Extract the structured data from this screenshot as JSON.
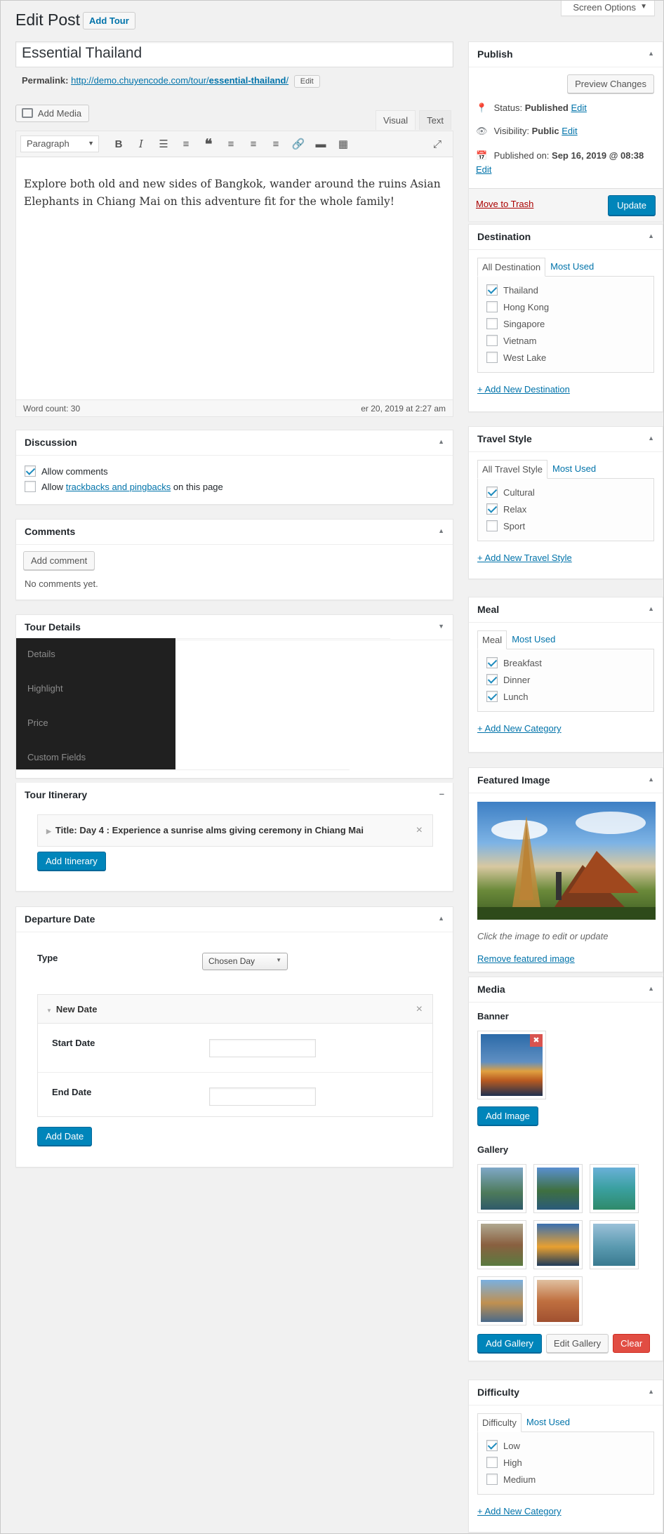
{
  "header": {
    "screen_options": "Screen Options",
    "page_title": "Edit Post",
    "add_tour": "Add Tour"
  },
  "post": {
    "title": "Essential Thailand",
    "permalink_label": "Permalink:",
    "permalink_base": "http://demo.chuyencode.com/tour/",
    "permalink_slug": "essential-thailand",
    "permalink_end": "/",
    "permalink_edit": "Edit"
  },
  "editor": {
    "add_media": "Add Media",
    "tab_visual": "Visual",
    "tab_text": "Text",
    "format_select": "Paragraph",
    "content": "Explore both old and new sides of Bangkok, wander around the ruins  Asian Elephants in Chiang Mai on this adventure fit for the whole family!",
    "word_count": "Word count: 30",
    "last_edited": "er 20, 2019 at 2:27 am"
  },
  "discussion": {
    "title": "Discussion",
    "allow_comments": "Allow comments",
    "allow_prefix": "Allow",
    "trackbacks_link": "trackbacks and pingbacks",
    "on_this_page": "on this page"
  },
  "comments": {
    "title": "Comments",
    "add_comment": "Add comment",
    "no_comments": "No comments yet."
  },
  "tour_details": {
    "title": "Tour Details",
    "nav": [
      "Details",
      "Highlight",
      "Price",
      "Custom Fields"
    ]
  },
  "itinerary": {
    "title": "Tour Itinerary",
    "item_title": "Title: Day 4 : Experience a sunrise alms giving ceremony in Chiang Mai",
    "add_button": "Add Itinerary"
  },
  "departure": {
    "title": "Departure Date",
    "type_label": "Type",
    "type_value": "Chosen Day",
    "new_date": "New Date",
    "start_label": "Start Date",
    "end_label": "End Date",
    "add_button": "Add Date"
  },
  "publish": {
    "title": "Publish",
    "preview": "Preview Changes",
    "status_label": "Status:",
    "status_value": "Published",
    "visibility_label": "Visibility:",
    "visibility_value": "Public",
    "published_label": "Published on:",
    "published_value": "Sep 16, 2019 @ 08:38",
    "edit": "Edit",
    "trash": "Move to Trash",
    "update": "Update"
  },
  "destination": {
    "title": "Destination",
    "tab_all": "All Destination",
    "tab_most": "Most Used",
    "items": [
      {
        "label": "Thailand",
        "checked": true
      },
      {
        "label": "Hong Kong",
        "checked": false
      },
      {
        "label": "Singapore",
        "checked": false
      },
      {
        "label": "Vietnam",
        "checked": false
      },
      {
        "label": "West Lake",
        "checked": false
      }
    ],
    "add_new": "+ Add New Destination"
  },
  "travel_style": {
    "title": "Travel Style",
    "tab_all": "All Travel Style",
    "tab_most": "Most Used",
    "items": [
      {
        "label": "Cultural",
        "checked": true
      },
      {
        "label": "Relax",
        "checked": true
      },
      {
        "label": "Sport",
        "checked": false
      }
    ],
    "add_new": "+ Add New Travel Style"
  },
  "meal": {
    "title": "Meal",
    "tab_all": "Meal",
    "tab_most": "Most Used",
    "items": [
      {
        "label": "Breakfast",
        "checked": true
      },
      {
        "label": "Dinner",
        "checked": true
      },
      {
        "label": "Lunch",
        "checked": true
      }
    ],
    "add_new": "+ Add New Category"
  },
  "featured_image": {
    "title": "Featured Image",
    "hint": "Click the image to edit or update",
    "remove": "Remove featured image"
  },
  "media": {
    "title": "Media",
    "banner_label": "Banner",
    "add_image": "Add Image",
    "gallery_label": "Gallery",
    "add_gallery": "Add Gallery",
    "edit_gallery": "Edit Gallery",
    "clear": "Clear"
  },
  "difficulty": {
    "title": "Difficulty",
    "tab_all": "Difficulty",
    "tab_most": "Most Used",
    "items": [
      {
        "label": "Low",
        "checked": true
      },
      {
        "label": "High",
        "checked": false
      },
      {
        "label": "Medium",
        "checked": false
      }
    ],
    "add_new": "+ Add New Category"
  },
  "colors": {
    "primary": "#0085ba",
    "link": "#0073aa",
    "danger": "#e14d43",
    "trash": "#a00"
  }
}
